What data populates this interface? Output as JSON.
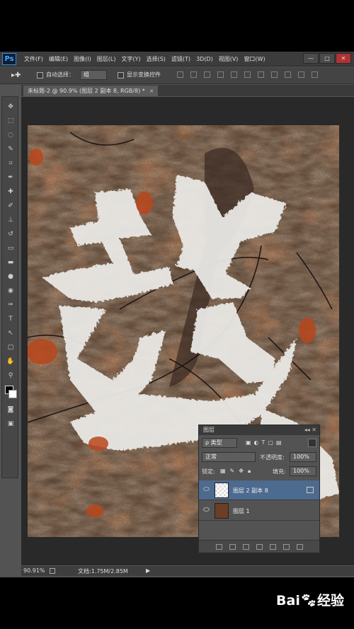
{
  "app": {
    "logo": "Ps",
    "menu": [
      "文件(F)",
      "编辑(E)",
      "图像(I)",
      "图层(L)",
      "文字(Y)",
      "选择(S)",
      "滤镜(T)",
      "3D(D)",
      "视图(V)",
      "窗口(W)"
    ],
    "window_buttons": [
      "—",
      "□",
      "✕"
    ]
  },
  "options_bar": {
    "tool_icon": "move-tool-icon",
    "auto_select_label": "自动选择：",
    "auto_select_value": "组",
    "show_transform_label": "显示变换控件"
  },
  "document_tab": {
    "title": "未标题-2 @ 90.9% (图层 2 副本 8, RGB/8) *",
    "close": "×"
  },
  "status_bar": {
    "zoom": "90.91%",
    "doc_info": "文档:1.75M/2.85M"
  },
  "layers_panel": {
    "title": "图层",
    "filter_label": "ρ 类型",
    "blend_mode": "正常",
    "opacity_label": "不透明度:",
    "opacity_value": "100%",
    "lock_label": "锁定:",
    "fill_label": "填充:",
    "fill_value": "100%",
    "layers": [
      {
        "name": "图层 2 副本 8",
        "selected": true
      },
      {
        "name": "图层 1",
        "selected": false
      }
    ],
    "footer_icons": [
      "link-icon",
      "fx-icon",
      "mask-icon",
      "adjustment-icon",
      "folder-icon",
      "new-layer-icon",
      "trash-icon"
    ]
  },
  "canvas_text": "越",
  "watermark": {
    "brand": "Bai",
    "suffix": "经验",
    "label": "du"
  },
  "colors": {
    "app_bg": "#535353",
    "selected_layer": "#4d6a8f",
    "rock_dark": "#4a3526",
    "rock_rust": "#a8431c"
  }
}
